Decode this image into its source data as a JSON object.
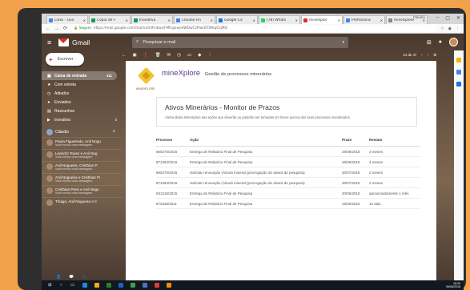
{
  "browser": {
    "tabs": [
      {
        "title": "Links - Goo",
        "color": "#4285f4"
      },
      {
        "title": "Cópia de F",
        "color": "#0f9d58"
      },
      {
        "title": "Inovativa",
        "color": "#0f9d58"
      },
      {
        "title": "Claudio Fin",
        "color": "#4285f4"
      },
      {
        "title": "Google Ca",
        "color": "#1a73e8"
      },
      {
        "title": "(78) Whats",
        "color": "#25d366"
      },
      {
        "title": "mineXplor",
        "color": "#d93025"
      },
      {
        "title": "Profissiona",
        "color": "#4285f4"
      },
      {
        "title": "mineXplore",
        "color": "#888888"
      }
    ],
    "profile": "Cláudio",
    "url": "https://mail.google.com/mail/u/0/#inbox/FMfcgxwcHWDwCzPlwrBTWhqCkjMQ",
    "secure_label": "Seguro"
  },
  "gmail": {
    "app_name": "Gmail",
    "search_placeholder": "Pesquisar e-mail",
    "compose": "Escrever",
    "folders": [
      {
        "label": "Caixa de entrada",
        "count": "111",
        "icon": "inbox-icon",
        "glyph": "▣"
      },
      {
        "label": "Com estrela",
        "count": "",
        "icon": "star-icon",
        "glyph": "★"
      },
      {
        "label": "Adiados",
        "count": "",
        "icon": "clock-icon",
        "glyph": "◷"
      },
      {
        "label": "Enviados",
        "count": "",
        "icon": "send-icon",
        "glyph": "➤"
      },
      {
        "label": "Rascunhos",
        "count": "",
        "icon": "draft-icon",
        "glyph": "▤"
      },
      {
        "label": "Inovativa",
        "count": "3",
        "icon": "label-icon",
        "glyph": "▶"
      }
    ],
    "hangouts_user": "Cláudio",
    "contacts": [
      {
        "name": "Paula Figueiredo, Anil Nogu",
        "status": "Você enviou uma mensagem"
      },
      {
        "name": "Leandro Touso e Anil Nog",
        "status": "Você enviou uma mensagem"
      },
      {
        "name": "Anil Nogueira, Cristhian P.",
        "status": "Você enviou uma mensagem"
      },
      {
        "name": "Anil Nogueira e Cristhian Pi",
        "status": "Você enviou uma mensagem"
      },
      {
        "name": "Cristhian Pires e Anil Nogu",
        "status": "Você enviou uma mensagem"
      },
      {
        "name": "Thiago, Anil Nogueira e C",
        "status": ""
      }
    ],
    "pager": "21 de 47"
  },
  "email": {
    "brand_name": "mineXplore",
    "brand_subtitle": "Gestão de processos minerários",
    "logo_label": "MINEXPLORE",
    "card_title": "Ativos Minerários - Monitor de Prazos",
    "card_text": "Alerta diário MineXplore das ações que deverão ou poderão ser tomadas em breve acerca dos seus processos monitorados.",
    "columns": [
      "Processo",
      "Ação",
      "Prazo",
      "Restam"
    ],
    "rows": [
      {
        "processo": "860270/2016",
        "acao": "Entrega de Relatório Final de Pesquisa",
        "prazo": "28/09/2018",
        "restam": "4 meses"
      },
      {
        "processo": "871364/2016",
        "acao": "Entrega de Relatório Final de Pesquisa",
        "prazo": "28/09/2018",
        "restam": "4 meses"
      },
      {
        "processo": "860270/2016",
        "acao": "Solicitar renovação (Alvará mineral (prorrogação do alvará de pesquisa)",
        "prazo": "30/07/2018",
        "restam": "2 meses"
      },
      {
        "processo": "871364/2016",
        "acao": "Solicitar renovação (Alvará mineral (prorrogação do alvará de pesquisa)",
        "prazo": "30/07/2018",
        "restam": "2 meses"
      },
      {
        "processo": "831215/2015",
        "acao": "Entrega de Relatório Final de Pesquisa",
        "prazo": "30/06/2018",
        "restam": "aproximadamente 1 mês"
      },
      {
        "processo": "872638/2011",
        "acao": "Entrega de Relatório Final de Pesquisa",
        "prazo": "15/06/2018",
        "restam": "10 dias"
      }
    ]
  },
  "taskbar": {
    "time": "18:00",
    "date": "06/06/2018"
  }
}
